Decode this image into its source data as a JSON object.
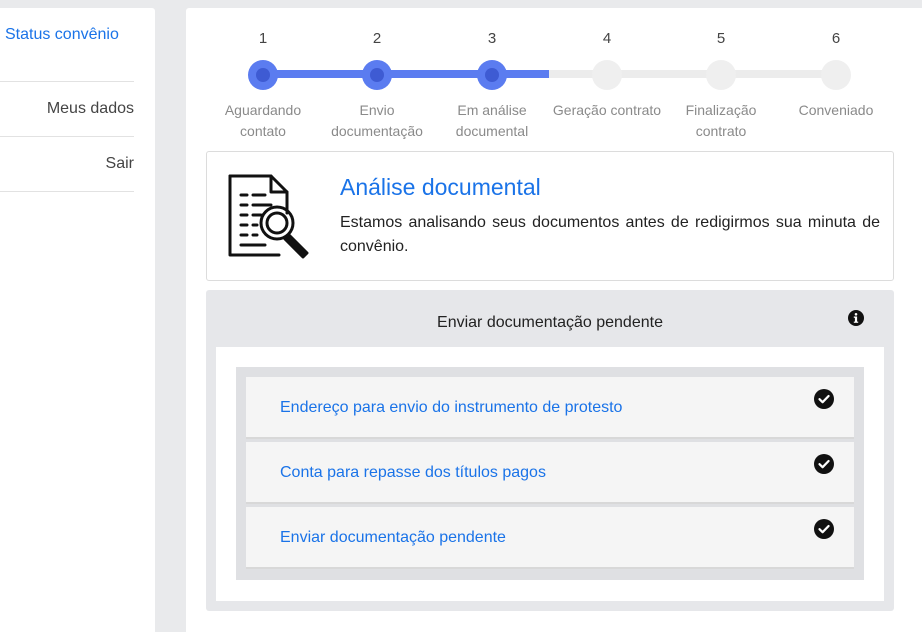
{
  "sidebar": {
    "items": [
      {
        "label": "Status convênio"
      },
      {
        "label": "Meus dados"
      },
      {
        "label": "Sair"
      }
    ]
  },
  "stepper": {
    "steps": [
      {
        "num": "1",
        "label": "Aguardando contato",
        "state": "done"
      },
      {
        "num": "2",
        "label": "Envio documentação",
        "state": "done"
      },
      {
        "num": "3",
        "label": "Em análise documental",
        "state": "done"
      },
      {
        "num": "4",
        "label": "Geração contrato",
        "state": "pending"
      },
      {
        "num": "5",
        "label": "Finalização contrato",
        "state": "pending"
      },
      {
        "num": "6",
        "label": "Conveniado",
        "state": "pending"
      }
    ]
  },
  "status_card": {
    "icon": "document-search-icon",
    "title": "Análise documental",
    "description": "Estamos analisando seus documentos antes de redigirmos sua minuta de convênio."
  },
  "pending_panel": {
    "title": "Enviar documentação pendente",
    "info_icon": "info-icon",
    "items": [
      {
        "label": "Endereço para envio do instrumento de protesto",
        "icon": "check-circle-icon"
      },
      {
        "label": "Conta para repasse dos títulos pagos",
        "icon": "check-circle-icon"
      },
      {
        "label": "Enviar documentação pendente",
        "icon": "check-circle-icon"
      }
    ]
  },
  "colors": {
    "accent": "#1a73e8",
    "stepper_done": "#5b7cf0",
    "stepper_done_inner": "#3e5bd3",
    "stepper_pending": "#ececec"
  }
}
